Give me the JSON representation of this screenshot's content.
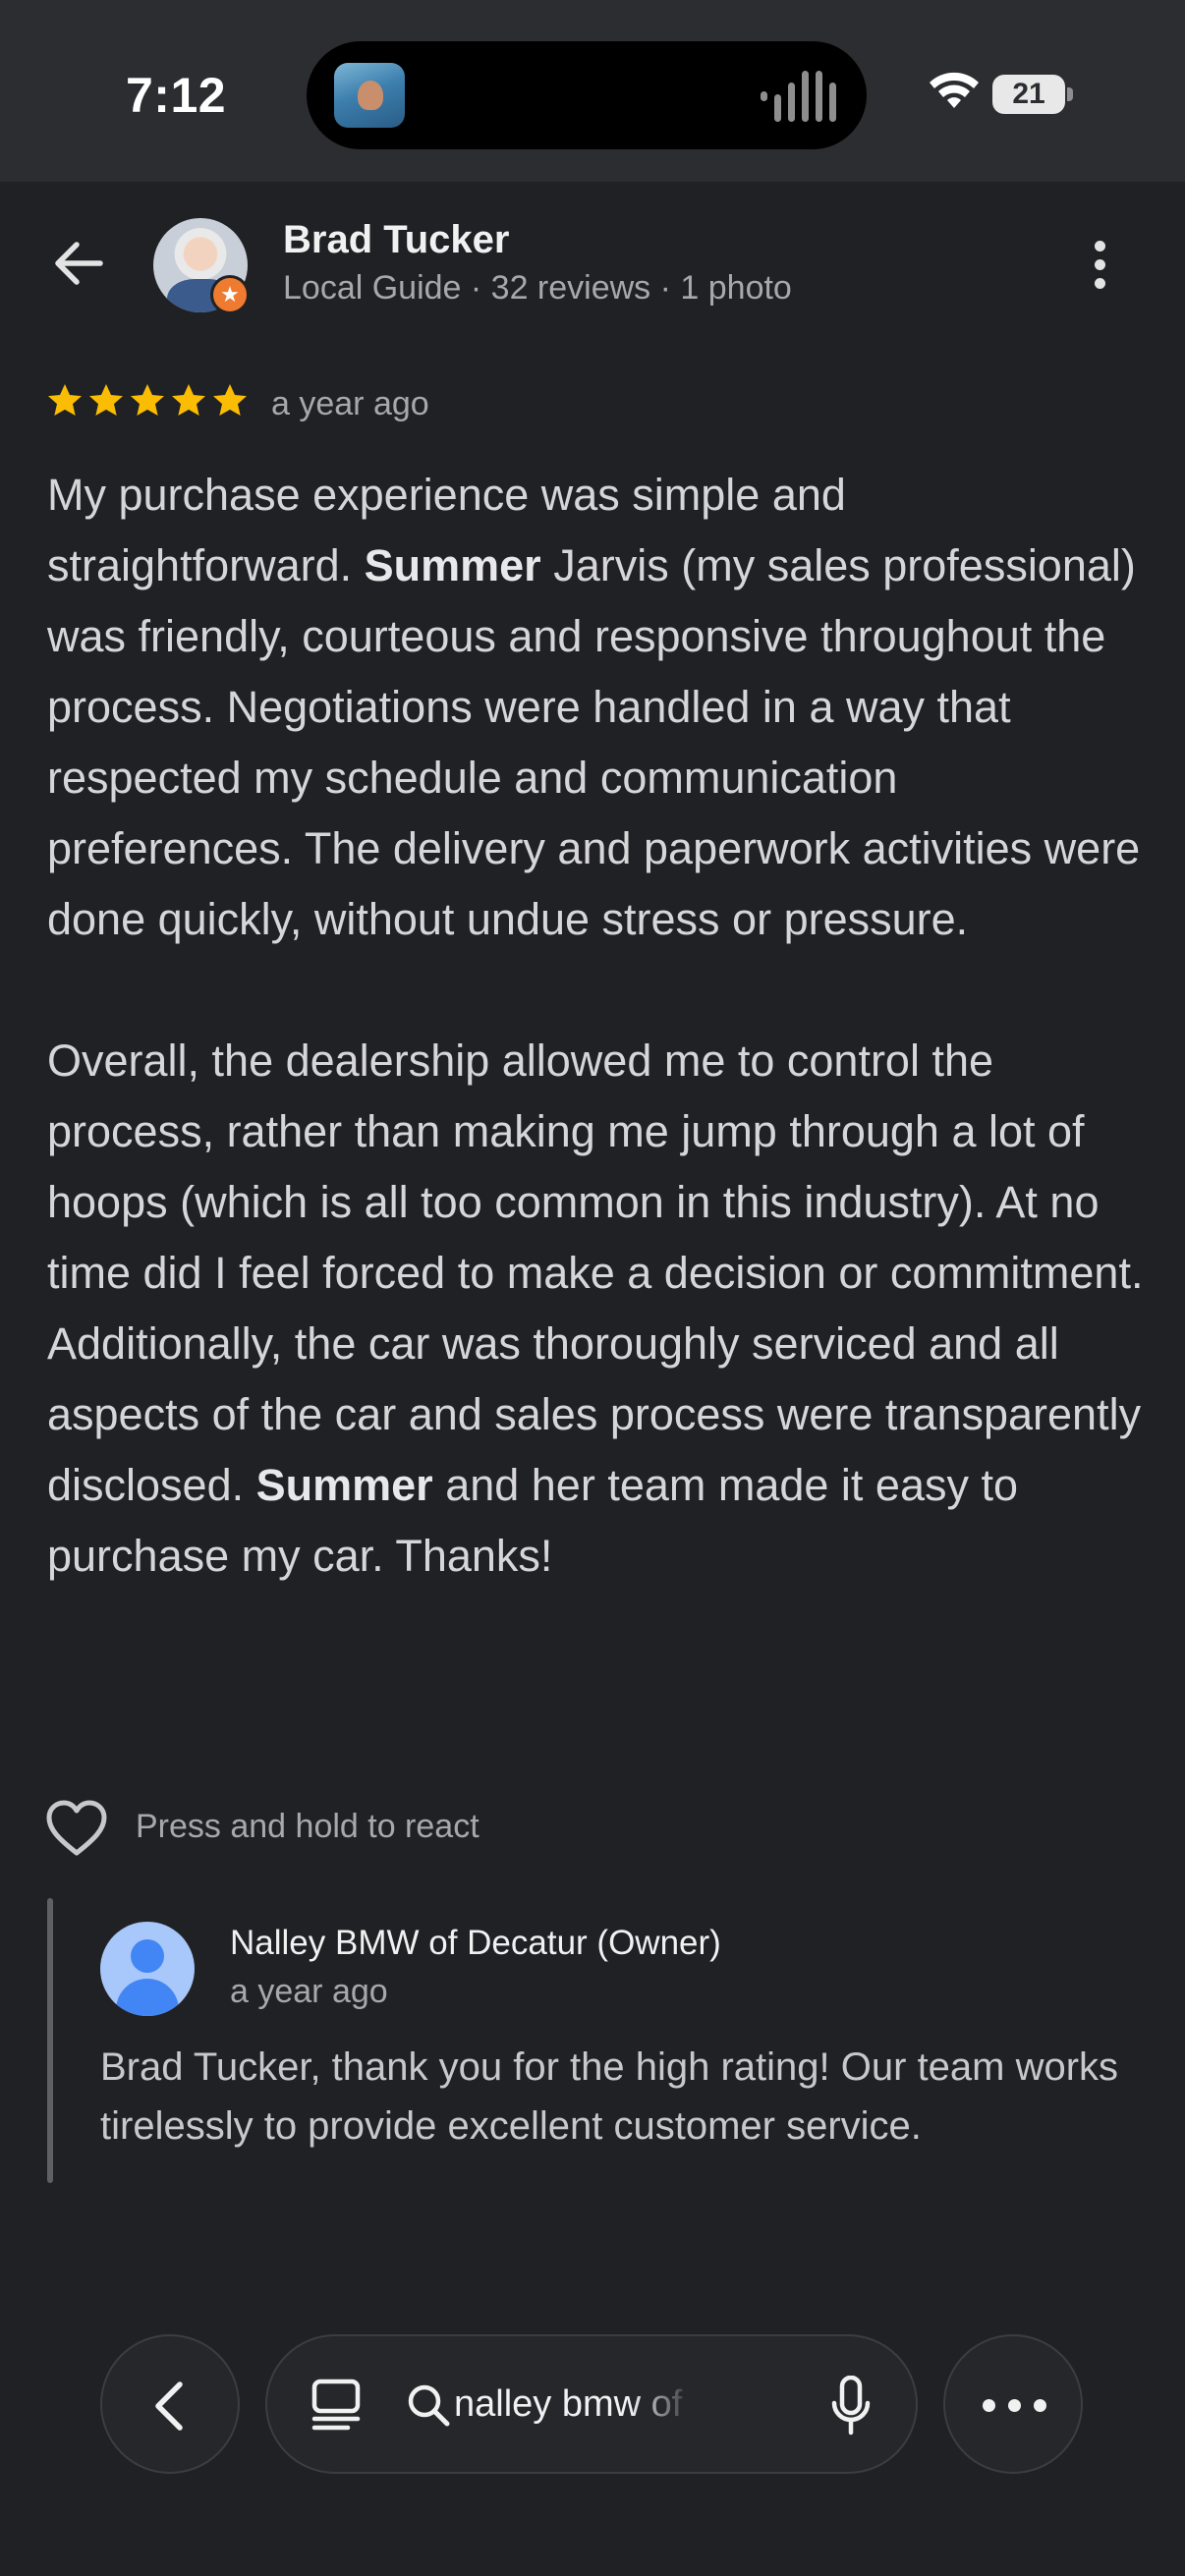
{
  "status_bar": {
    "time": "7:12",
    "battery": "21"
  },
  "header": {
    "reviewer_name": "Brad Tucker",
    "reviewer_meta": "Local Guide · 32 reviews · 1 photo"
  },
  "review": {
    "rating": 5,
    "date": "a year ago",
    "paragraph1": [
      "My purchase experience was simple and straightforward. ",
      "Summer",
      " Jarvis (my sales professional) was friendly, courteous and responsive throughout the process. Negotiations were handled in a way that respected my schedule and communication preferences. The delivery and paperwork activities were done quickly, without undue stress or pressure."
    ],
    "paragraph2": [
      "Overall, the dealership allowed me to control the process, rather than making me jump through a lot of hoops (which is all too common in this industry). At no time did I feel forced to make a decision or commitment. Additionally, the car was thoroughly serviced and all aspects of the car and sales process were transparently disclosed. ",
      "Summer",
      " and her team made it easy to purchase my car. Thanks!"
    ]
  },
  "react": {
    "label": "Press and hold to react"
  },
  "owner_response": {
    "name": "Nalley BMW of Decatur (Owner)",
    "date": "a year ago",
    "text": "Brad Tucker, thank you for the high rating! Our team works tirelessly to provide excellent customer service."
  },
  "bottom_bar": {
    "search_text": "nalley bmw of decatur"
  },
  "colors": {
    "background": "#202124",
    "star": "#fbbc04",
    "local_guide_badge": "#ef7b31",
    "owner_avatar": "#4285f4"
  }
}
